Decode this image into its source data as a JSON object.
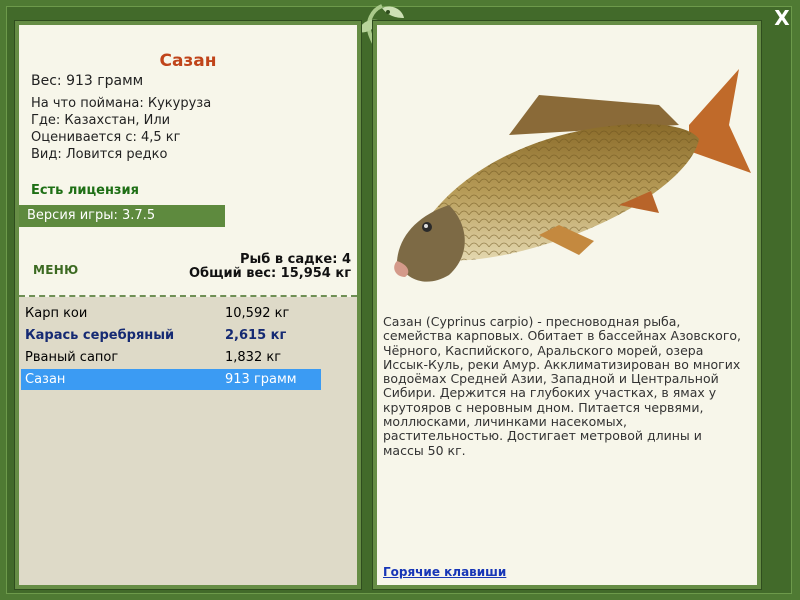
{
  "close_label": "X",
  "fish": {
    "title": "Сазан",
    "weight": "Вес: 913 грамм",
    "bait": "На что поймана: Кукуруза",
    "location": "Где: Казахстан, Или",
    "value": "Оценивается с: 4,5 кг",
    "rarity": "Вид: Ловится редко"
  },
  "license": "Есть лицензия",
  "version": "Версия игры: 3.7.5",
  "menu_label": "МЕНЮ",
  "stats": {
    "count": "Рыб в садке: 4",
    "total": "Общий вес: 15,954 кг"
  },
  "catch_list": [
    {
      "name": "Карп кои",
      "weight": "10,592 кг"
    },
    {
      "name": "Карась серебряный",
      "weight": "2,615 кг"
    },
    {
      "name": "Рваный сапог",
      "weight": "1,832 кг"
    },
    {
      "name": "Сазан",
      "weight": "913 грамм"
    }
  ],
  "description": "Сазан (Cyprinus carpio) - пресноводная рыба, семейства карповых. Обитает в бассейнах Азовского, Чёрного, Каспийского, Аральского морей, озера Иссык-Куль, реки Амур. Акклиматизирован во многих водоёмах Средней Азии, Западной и Центральной Сибири. Держится на глубоких участках, в ямах у крутояров с неровным дном. Питается червями, моллюсками, личинками насекомых, растительностью. Достигает метровой длины и массы 50 кг.",
  "hotkeys_label": "Горячие клавиши",
  "colors": {
    "frame": "#4f7a33",
    "panel": "#f7f6ea",
    "title": "#c0441a",
    "license": "#1e6f15",
    "selected": "#3b9bf3",
    "link": "#1736b7"
  },
  "icons": {
    "close": "close-icon",
    "logo": "leaf-logo-icon",
    "fish": "carp-fish-image"
  }
}
